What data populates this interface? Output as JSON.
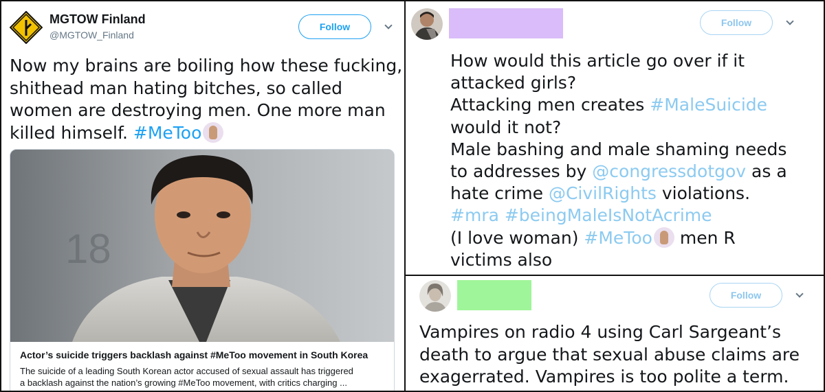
{
  "tweet1": {
    "author_name": "MGTOW Finland",
    "author_handle": "@MGTOW_Finland",
    "follow_label": "Follow",
    "text_lines": [
      "Now my brains are boiling how these fucking,",
      "shithead man hating bitches, so called",
      "women are destroying men. One more man",
      "killed himself. "
    ],
    "hashtag": "#MeToo",
    "card": {
      "title": "Actor’s suicide triggers backlash against #MeToo movement in South Korea",
      "description_lines": [
        "The suicide of a leading South Korean actor accused of sexual assault has triggered",
        "a backlash against the nation’s growing #MeToo movement, with critics charging ..."
      ]
    }
  },
  "tweet2": {
    "follow_label": "Follow",
    "redaction_color": "#d9bcf9",
    "line1": "How would this article go over if it",
    "line2": "attacked girls?",
    "line3_pre": "Attacking men creates ",
    "line3_tag": "#MaleSuicide",
    "line4": "would it not?",
    "line5": "Male bashing and male shaming needs",
    "line6_pre": "to addresses by ",
    "line6_tag": "@congressdotgov",
    "line6_post": " as a",
    "line7_pre": "hate crime ",
    "line7_tag": "@CivilRights",
    "line7_post": " violations.",
    "line8_tag1": "#mra",
    "line8_tag2": "#beingMaleIsNotAcrime",
    "line9_pre": "(I love woman) ",
    "line9_tag": "#MeToo",
    "line9_post": " men R",
    "line10": "victims also"
  },
  "tweet3": {
    "follow_label": "Follow",
    "redaction_color": "#9ff59a",
    "text_lines": [
      "Vampires on radio 4 using Carl Sargeant’s",
      "death to argue that sexual abuse claims are",
      "exagerrated. Vampires is too polite a term."
    ]
  },
  "colors": {
    "link": "#1da1f2",
    "link_light": "#8ccaf0",
    "logo_yellow": "#f2c200"
  }
}
